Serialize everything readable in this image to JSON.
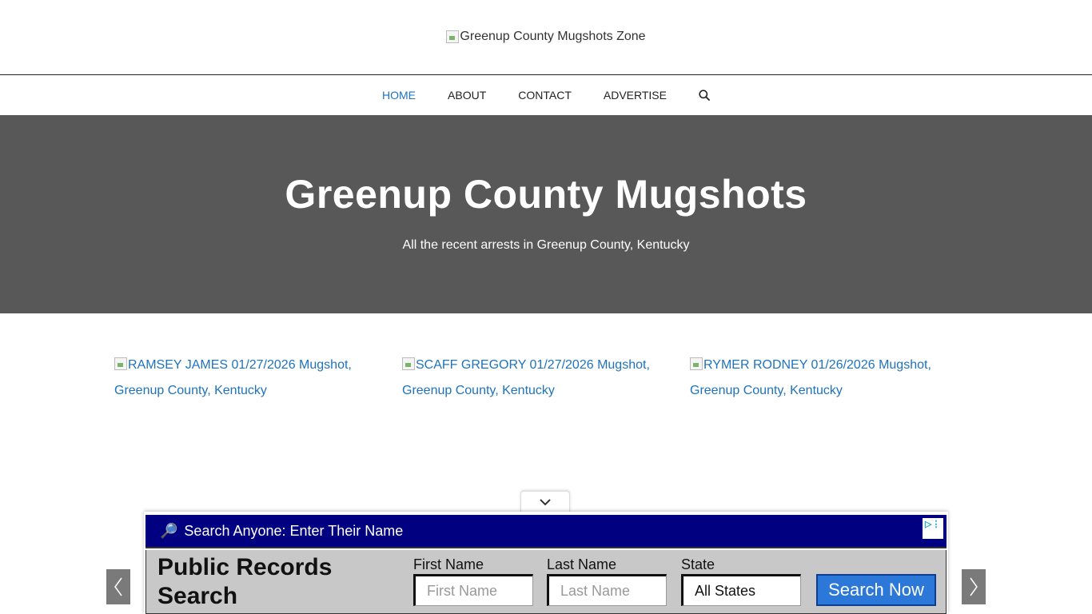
{
  "header": {
    "logo_alt": "Greenup County Mugshots Zone"
  },
  "nav": {
    "items": [
      {
        "label": "HOME"
      },
      {
        "label": "ABOUT"
      },
      {
        "label": "CONTACT"
      },
      {
        "label": "ADVERTISE"
      }
    ]
  },
  "hero": {
    "title": "Greenup County Mugshots",
    "subtitle": "All the recent arrests in Greenup County, Kentucky"
  },
  "cards": [
    {
      "alt": "RAMSEY JAMES 01/27/2026 Mugshot, Greenup County, Kentucky"
    },
    {
      "alt": "SCAFF GREGORY 01/27/2026 Mugshot, Greenup County, Kentucky"
    },
    {
      "alt": "RYMER RODNEY 01/26/2026 Mugshot, Greenup County, Kentucky"
    }
  ],
  "ad": {
    "banner_text": "Search Anyone: Enter Their Name",
    "headline": "Public Records Search",
    "first_name_label": "First Name",
    "first_name_placeholder": "First Name",
    "last_name_label": "Last Name",
    "last_name_placeholder": "Last Name",
    "state_label": "State",
    "state_value": "All States",
    "button_label": "Search Now"
  },
  "colors": {
    "accent": "#1e73be",
    "hero_bg": "#585858",
    "ad_banner": "#000080",
    "ad_button": "#2c78d8"
  }
}
